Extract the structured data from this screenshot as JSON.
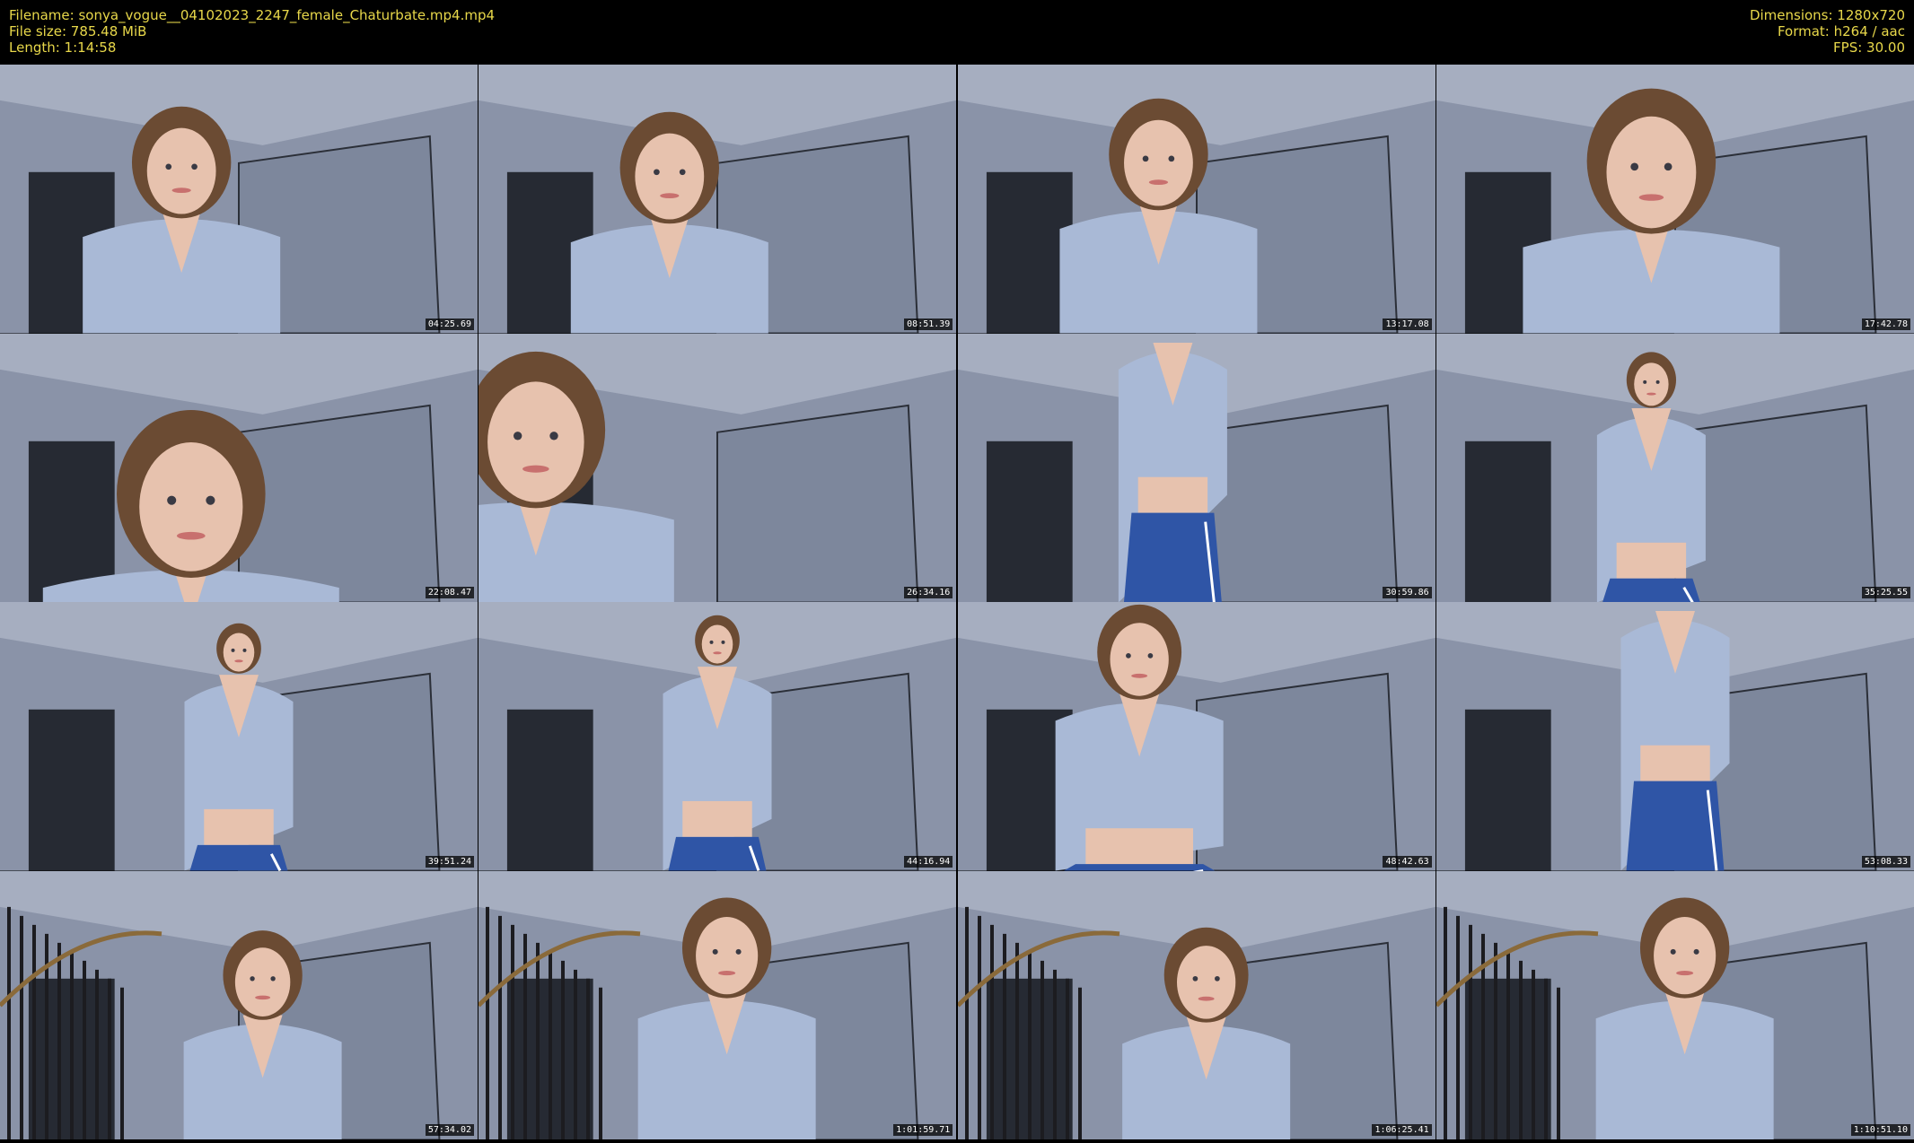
{
  "header": {
    "filename": "Filename: sonya_vogue__04102023_2247_female_Chaturbate.mp4.mp4",
    "filesize": "File size: 785.48 MiB",
    "length": "Length: 1:14:58",
    "dimensions": "Dimensions: 1280x720",
    "format": "Format: h264 / aac",
    "fps": "FPS: 30.00"
  },
  "thumbnails": [
    {
      "timestamp": "04:25.69",
      "scene": "face-hair"
    },
    {
      "timestamp": "08:51.39",
      "scene": "face"
    },
    {
      "timestamp": "13:17.08",
      "scene": "face-smile"
    },
    {
      "timestamp": "17:42.78",
      "scene": "face-smile-close"
    },
    {
      "timestamp": "22:08.47",
      "scene": "face-close"
    },
    {
      "timestamp": "26:34.16",
      "scene": "face-side"
    },
    {
      "timestamp": "30:59.86",
      "scene": "torso"
    },
    {
      "timestamp": "35:25.55",
      "scene": "standing-phone"
    },
    {
      "timestamp": "39:51.24",
      "scene": "standing-full"
    },
    {
      "timestamp": "44:16.94",
      "scene": "standing-side"
    },
    {
      "timestamp": "48:42.63",
      "scene": "leaning"
    },
    {
      "timestamp": "53:08.33",
      "scene": "closeup-shorts"
    },
    {
      "timestamp": "57:34.02",
      "scene": "stairs-side"
    },
    {
      "timestamp": "1:01:59.71",
      "scene": "stairs-front"
    },
    {
      "timestamp": "1:06:25.41",
      "scene": "stairs-front-2"
    },
    {
      "timestamp": "1:10:51.10",
      "scene": "stairs-tilt"
    }
  ],
  "colors": {
    "header_text": "#e8d84a",
    "wall": "#8a93a8",
    "ceiling": "#a6aec0",
    "shirt": "#a9b9d6",
    "shorts": "#2f55a6",
    "skin": "#e7c2ae",
    "hair": "#6b4b33"
  }
}
